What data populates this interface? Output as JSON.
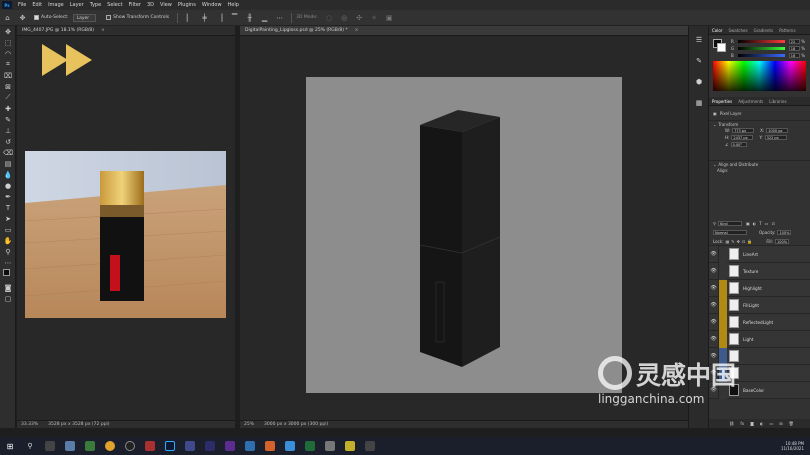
{
  "menubar": {
    "app_icon": "Ps",
    "items": [
      "File",
      "Edit",
      "Image",
      "Layer",
      "Type",
      "Select",
      "Filter",
      "3D",
      "View",
      "Plugins",
      "Window",
      "Help"
    ]
  },
  "options_bar": {
    "auto_select_label": "Auto-Select:",
    "auto_select_value": "Layer",
    "show_transform_label": "Show Transform Controls",
    "mode_label": "3D Mode:"
  },
  "documents": {
    "left": {
      "tab_title": "IMG_4407.JPG @ 18.1% (RGB/8)",
      "zoom": "33.33%",
      "size": "3528 px x 3528 px (72 ppi)"
    },
    "right": {
      "tab_title": "DigitalPainting_Lipgloss.psd @ 25% (RGB/8) *",
      "zoom": "25%",
      "size": "3000 px x 3000 px (300 ppi)"
    }
  },
  "panels": {
    "color": {
      "tabs": [
        "Color",
        "Swatches",
        "Gradients",
        "Patterns"
      ],
      "channels": [
        {
          "label": "R",
          "value": "22",
          "color": "#ff3b3b"
        },
        {
          "label": "G",
          "value": "18",
          "color": "#3bff3b"
        },
        {
          "label": "B",
          "value": "16",
          "color": "#3b6bff"
        }
      ],
      "unit": "%"
    },
    "properties": {
      "tabs": [
        "Properties",
        "Adjustments",
        "Libraries"
      ],
      "layer_type": "Pixel Layer",
      "transform_label": "Transform",
      "w_label": "W:",
      "w_value": "773 px",
      "x_label": "X:",
      "x_value": "1000 px",
      "h_label": "H:",
      "h_value": "2437 px",
      "y_label": "Y:",
      "y_value": "322 px",
      "angle_value": "0.00°",
      "align_label": "Align and Distribute",
      "align_sub": "Align:"
    },
    "layers": {
      "tabs": [
        "Layers",
        "Channels",
        "Paths"
      ],
      "kind_label": "Kind",
      "blend_mode": "Normal",
      "opacity_label": "Opacity:",
      "opacity_value": "100%",
      "lock_label": "Lock:",
      "fill_label": "Fill:",
      "fill_value": "100%",
      "items": [
        {
          "name": "LineArt",
          "tag": "#353535"
        },
        {
          "name": "Texture",
          "tag": "#353535"
        },
        {
          "name": "Highlight",
          "tag": "#b18a12"
        },
        {
          "name": "FillLight",
          "tag": "#b18a12"
        },
        {
          "name": "ReflectedLight",
          "tag": "#b18a12"
        },
        {
          "name": "Light",
          "tag": "#b18a12"
        },
        {
          "name": "",
          "tag": "#3d5a8a"
        },
        {
          "name": "",
          "tag": "#3d5a8a"
        },
        {
          "name": "BaseColor",
          "tag": "#353535"
        }
      ]
    }
  },
  "taskbar": {
    "time": "10:48 PM",
    "date": "11/16/2021"
  },
  "watermark": {
    "title": "灵感中国",
    "url": "lingganchina.com"
  }
}
